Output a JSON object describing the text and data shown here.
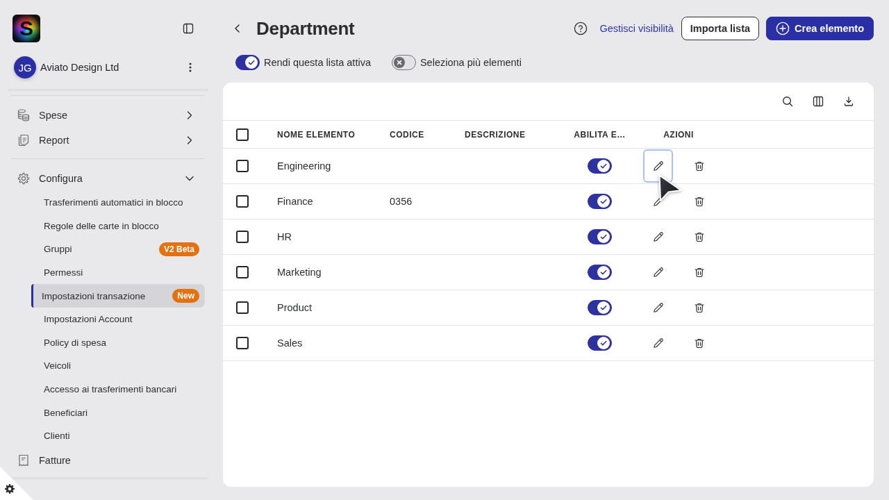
{
  "sidebar": {
    "logo_letter": "S",
    "account": {
      "initials": "JG",
      "name": "Aviato Design Ltd"
    },
    "nav_sections": [
      {
        "items": [
          {
            "label": "Spese",
            "kind": "group",
            "expanded": false
          },
          {
            "label": "Report",
            "kind": "group",
            "expanded": false
          }
        ]
      },
      {
        "items": [
          {
            "label": "Configura",
            "kind": "group",
            "expanded": true,
            "children": [
              {
                "label": "Trasferimenti automatici in blocco",
                "selected": false
              },
              {
                "label": "Regole delle carte in blocco",
                "selected": false
              },
              {
                "label": "Gruppi",
                "selected": false,
                "badge": "V2 Beta"
              },
              {
                "label": "Permessi",
                "selected": false
              },
              {
                "label": "Impostazioni transazione",
                "selected": true,
                "badge": "New"
              },
              {
                "label": "Impostazioni Account",
                "selected": false
              },
              {
                "label": "Policy di spesa",
                "selected": false
              },
              {
                "label": "Veicoli",
                "selected": false
              },
              {
                "label": "Accesso ai trasferimenti bancari",
                "selected": false
              },
              {
                "label": "Beneficiari",
                "selected": false
              },
              {
                "label": "Clienti",
                "selected": false
              }
            ]
          },
          {
            "label": "Fatture",
            "kind": "link"
          }
        ]
      }
    ]
  },
  "page": {
    "title": "Department",
    "help_link": "Gestisci visibilità",
    "actions": [
      {
        "label": "Importa lista",
        "kind": "secondary"
      },
      {
        "label": "Crea elemento",
        "kind": "primary"
      }
    ]
  },
  "switches": [
    {
      "label": "Rendi questa lista attiva",
      "on": true
    },
    {
      "label": "Seleziona più elementi",
      "on": false
    }
  ],
  "table": {
    "select_all_checked": false,
    "columns": [
      "NOME ELEMENTO",
      "CODICE",
      "DESCRIZIONE",
      "ABILITA E…",
      "AZIONI"
    ],
    "rows": [
      {
        "name": "Engineering",
        "checked": false,
        "enabled": true,
        "edit_focused": true
      },
      {
        "name": "Finance",
        "code": "0356",
        "checked": false,
        "enabled": true,
        "edit_focused": false
      },
      {
        "name": "HR",
        "checked": false,
        "enabled": true,
        "edit_focused": false
      },
      {
        "name": "Marketing",
        "checked": false,
        "enabled": true,
        "edit_focused": false
      },
      {
        "name": "Product",
        "checked": false,
        "enabled": true,
        "edit_focused": false
      },
      {
        "name": "Sales",
        "checked": false,
        "enabled": true,
        "edit_focused": false
      }
    ]
  }
}
